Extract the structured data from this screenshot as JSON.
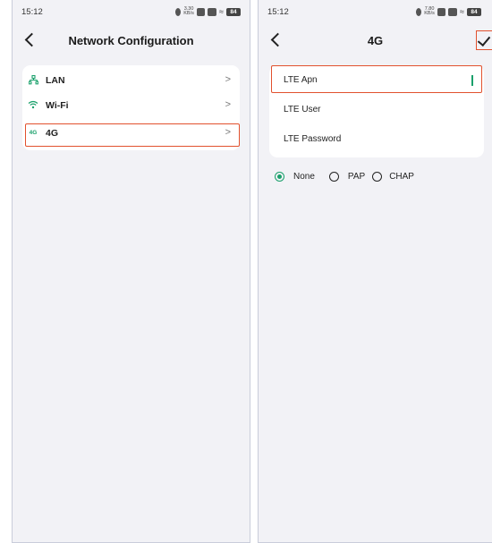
{
  "left_screen": {
    "status": {
      "time": "15:12",
      "speed": "3.30\nKB/s",
      "battery": "84"
    },
    "title": "Network Configuration",
    "items": [
      {
        "label": "LAN",
        "icon": "ethernet-icon",
        "chevron": ">"
      },
      {
        "label": "Wi-Fi",
        "icon": "wifi-icon",
        "chevron": ">"
      },
      {
        "label": "4G",
        "icon": "cellular-4g-icon",
        "icon_text": "4G",
        "chevron": ">"
      }
    ]
  },
  "right_screen": {
    "status": {
      "time": "15:12",
      "speed": "7.80\nKB/s",
      "battery": "84"
    },
    "title": "4G",
    "fields": [
      {
        "label": "LTE Apn",
        "value": ""
      },
      {
        "label": "LTE User",
        "value": ""
      },
      {
        "label": "LTE Password",
        "value": ""
      }
    ],
    "auth_options": [
      {
        "label": "None",
        "selected": true
      },
      {
        "label": "PAP",
        "selected": false
      },
      {
        "label": "CHAP",
        "selected": false
      }
    ]
  },
  "colors": {
    "accent": "#1aa06b",
    "highlight": "#e2512e",
    "background": "#f2f2f6"
  }
}
